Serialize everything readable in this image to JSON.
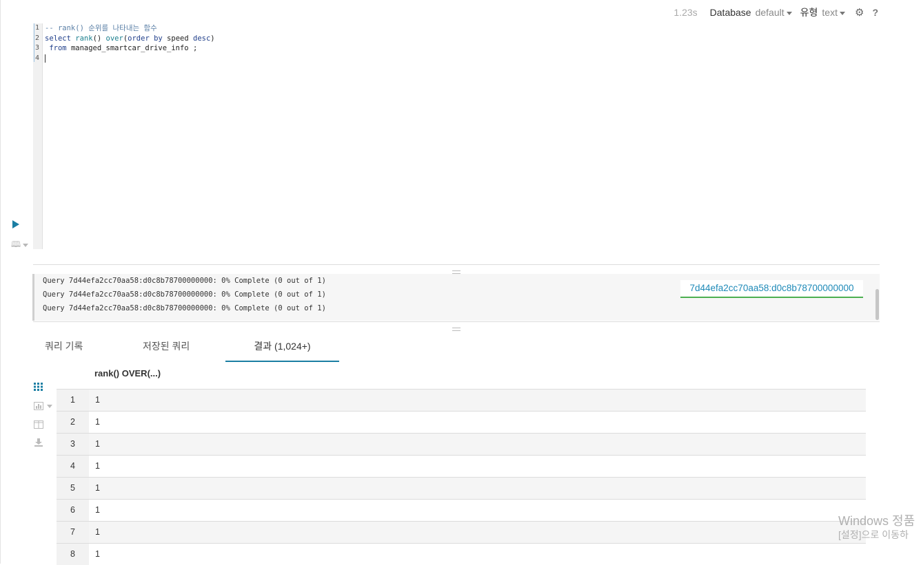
{
  "toolbar": {
    "time": "1.23s",
    "database_label": "Database",
    "database_value": "default",
    "type_label": "유형",
    "type_value": "text",
    "help": "?"
  },
  "editor": {
    "line_numbers": [
      "1",
      "2",
      "3",
      "4"
    ],
    "lines": [
      [
        {
          "t": "-- rank() 순위를 나타내는 함수",
          "c": "comment"
        }
      ],
      [
        {
          "t": "select ",
          "c": "kw"
        },
        {
          "t": "rank",
          "c": "fn"
        },
        {
          "t": "() ",
          "c": "ident"
        },
        {
          "t": "over",
          "c": "fn"
        },
        {
          "t": "(",
          "c": "ident"
        },
        {
          "t": "order by",
          "c": "kw"
        },
        {
          "t": " speed ",
          "c": "ident"
        },
        {
          "t": "desc",
          "c": "kw"
        },
        {
          "t": ")",
          "c": "ident"
        }
      ],
      [
        {
          "t": " from ",
          "c": "kw"
        },
        {
          "t": "managed_smartcar_drive_info ;",
          "c": "ident"
        }
      ],
      []
    ]
  },
  "log": {
    "lines": [
      "Query 7d44efa2cc70aa58:d0c8b78700000000: 0% Complete (0 out of 1)",
      "Query 7d44efa2cc70aa58:d0c8b78700000000: 0% Complete (0 out of 1)",
      "Query 7d44efa2cc70aa58:d0c8b78700000000: 0% Complete (0 out of 1)"
    ],
    "query_id": "7d44efa2cc70aa58:d0c8b78700000000"
  },
  "tabs": [
    {
      "label": "쿼리 기록",
      "active": false
    },
    {
      "label": "저장된 쿼리",
      "active": false
    },
    {
      "label": "결과 (1,024+)",
      "active": true
    }
  ],
  "results": {
    "column": "rank() OVER(...)",
    "rows": [
      {
        "n": "1",
        "v": "1"
      },
      {
        "n": "2",
        "v": "1"
      },
      {
        "n": "3",
        "v": "1"
      },
      {
        "n": "4",
        "v": "1"
      },
      {
        "n": "5",
        "v": "1"
      },
      {
        "n": "6",
        "v": "1"
      },
      {
        "n": "7",
        "v": "1"
      },
      {
        "n": "8",
        "v": "1"
      }
    ]
  },
  "side_icons": [
    "grid-icon",
    "bar-chart-icon",
    "columns-icon",
    "download-icon"
  ],
  "watermark": {
    "line1": "Windows 정품",
    "line2": "[설정]으로 이동하"
  },
  "colors": {
    "accent": "#1a7ea3",
    "link": "#1e8ab8",
    "success_underline": "#4caf50"
  }
}
